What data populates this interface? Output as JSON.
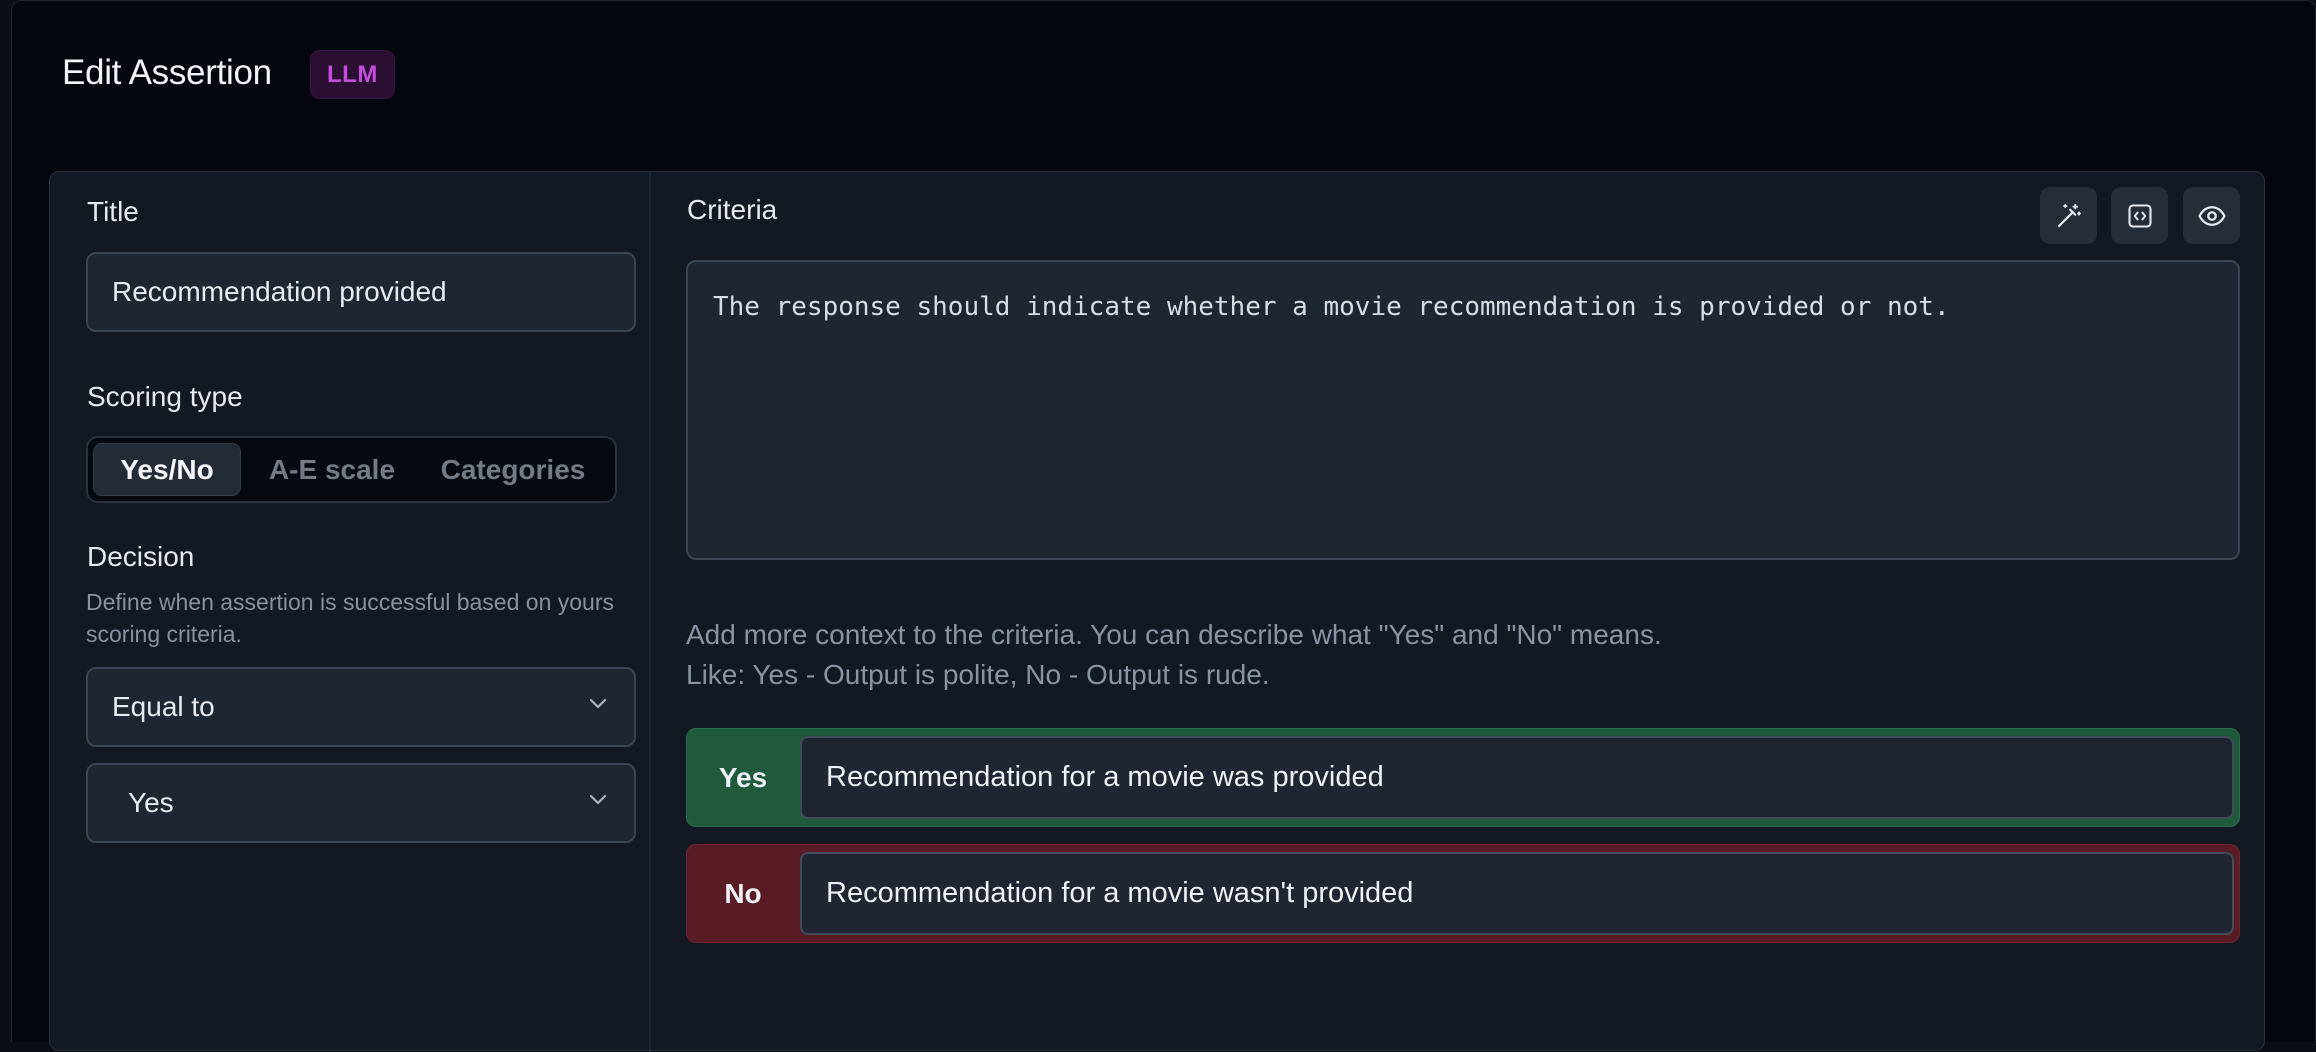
{
  "dialog": {
    "title": "Edit Assertion",
    "badge": "LLM"
  },
  "left": {
    "title_label": "Title",
    "title_value": "Recommendation provided",
    "scoring_label": "Scoring type",
    "scoring_options": [
      "Yes/No",
      "A-E scale",
      "Categories"
    ],
    "scoring_selected": "Yes/No",
    "decision_label": "Decision",
    "decision_help": "Define when assertion is successful based on yours scoring criteria.",
    "operator_value": "Equal to",
    "target_value": "Yes"
  },
  "right": {
    "criteria_label": "Criteria",
    "criteria_text": "The response should indicate whether a movie recommendation is provided or not.",
    "toolbar_icons": [
      "magic-wand-icon",
      "code-icon",
      "eye-icon"
    ],
    "context_help_line1": "Add more context to the criteria. You can describe what \"Yes\" and \"No\" means.",
    "context_help_line2": "Like: Yes - Output is polite, No - Output is rude.",
    "outcomes": [
      {
        "tag": "Yes",
        "description": "Recommendation for a movie was provided",
        "color": "#1f5a3c"
      },
      {
        "tag": "No",
        "description": "Recommendation for a movie wasn't provided",
        "color": "#5a1c24"
      }
    ]
  },
  "colors": {
    "badge_text": "#c64bdf",
    "badge_bg": "#2a0f33",
    "yes_bg": "#1f5a3c",
    "no_bg": "#5a1c24"
  }
}
